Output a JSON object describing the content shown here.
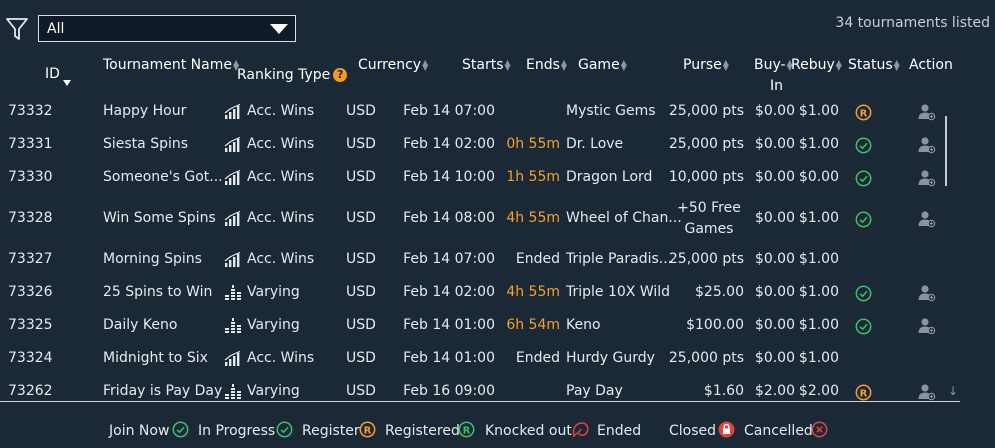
{
  "toolbar": {
    "filter_value": "All",
    "count_text": "34 tournaments listed"
  },
  "columns": {
    "id": "ID",
    "name": "Tournament Name",
    "ranking": "Ranking Type",
    "currency": "Currency",
    "starts": "Starts",
    "ends": "Ends",
    "game": "Game",
    "purse": "Purse",
    "buyin_1": "Buy-",
    "buyin_2": "In",
    "rebuy": "Rebuy",
    "status": "Status",
    "action": "Action"
  },
  "rows": [
    {
      "id": "73332",
      "name": "Happy Hour",
      "ranking_icon": "bar-chart-icon",
      "ranking": "Acc. Wins",
      "currency": "USD",
      "starts": "Feb 14 07:00",
      "ends": "",
      "ends_color": "",
      "game": "Mystic Gems",
      "purse": "25,000 pts",
      "purse2": "",
      "buyin": "$0.00",
      "rebuy": "$1.00",
      "status": "register",
      "action": "join-user-icon"
    },
    {
      "id": "73331",
      "name": "Siesta Spins",
      "ranking_icon": "bar-chart-icon",
      "ranking": "Acc. Wins",
      "currency": "USD",
      "starts": "Feb 14 02:00",
      "ends": "0h 55m",
      "ends_color": "#f5a030",
      "game": "Dr. Love",
      "purse": "25,000 pts",
      "purse2": "",
      "buyin": "$0.00",
      "rebuy": "$1.00",
      "status": "in-progress",
      "action": "join-user-icon"
    },
    {
      "id": "73330",
      "name": "Someone's Got...",
      "ranking_icon": "bar-chart-icon",
      "ranking": "Acc. Wins",
      "currency": "USD",
      "starts": "Feb 14 10:00",
      "ends": "1h 55m",
      "ends_color": "#f5a030",
      "game": "Dragon Lord",
      "purse": "10,000 pts",
      "purse2": "",
      "buyin": "$0.00",
      "rebuy": "$0.00",
      "status": "in-progress",
      "action": "join-user-icon"
    },
    {
      "id": "73328",
      "name": "Win Some Spins",
      "ranking_icon": "bar-chart-icon",
      "ranking": "Acc. Wins",
      "currency": "USD",
      "starts": "Feb 14 08:00",
      "ends": "4h 55m",
      "ends_color": "#f5a030",
      "game": "Wheel of Chan...",
      "purse": "+50 Free",
      "purse2": "Games",
      "buyin": "$0.00",
      "rebuy": "$1.00",
      "status": "in-progress",
      "action": "join-user-icon"
    },
    {
      "id": "73327",
      "name": "Morning Spins",
      "ranking_icon": "bar-chart-icon",
      "ranking": "Acc. Wins",
      "currency": "USD",
      "starts": "Feb 14 07:00",
      "ends": "Ended",
      "ends_color": "",
      "game": "Triple Paradis...",
      "purse": "25,000 pts",
      "purse2": "",
      "buyin": "$0.00",
      "rebuy": "$1.00",
      "status": "",
      "action": ""
    },
    {
      "id": "73326",
      "name": "25 Spins to Win",
      "ranking_icon": "coin-stack-icon",
      "ranking": "Varying",
      "currency": "USD",
      "starts": "Feb 14 02:00",
      "ends": "4h 55m",
      "ends_color": "#f5a030",
      "game": "Triple 10X Wild",
      "purse": "$25.00",
      "purse2": "",
      "buyin": "$0.00",
      "rebuy": "$1.00",
      "status": "in-progress",
      "action": "join-user-icon"
    },
    {
      "id": "73325",
      "name": "Daily Keno",
      "ranking_icon": "coin-stack-icon",
      "ranking": "Varying",
      "currency": "USD",
      "starts": "Feb 14 01:00",
      "ends": "6h 54m",
      "ends_color": "#f5a030",
      "game": "Keno",
      "purse": "$100.00",
      "purse2": "",
      "buyin": "$0.00",
      "rebuy": "$1.00",
      "status": "in-progress",
      "action": "join-user-icon"
    },
    {
      "id": "73324",
      "name": "Midnight to Six",
      "ranking_icon": "bar-chart-icon",
      "ranking": "Acc. Wins",
      "currency": "USD",
      "starts": "Feb 14 01:00",
      "ends": "Ended",
      "ends_color": "",
      "game": "Hurdy Gurdy",
      "purse": "25,000 pts",
      "purse2": "",
      "buyin": "$0.00",
      "rebuy": "$1.00",
      "status": "",
      "action": ""
    },
    {
      "id": "73262",
      "name": "Friday is Pay Day",
      "ranking_icon": "coin-stack-icon",
      "ranking": "Varying",
      "currency": "USD",
      "starts": "Feb 16 09:00",
      "ends": "",
      "ends_color": "",
      "game": "Pay Day",
      "purse": "$1.60",
      "purse2": "",
      "buyin": "$2.00",
      "rebuy": "$2.00",
      "status": "register",
      "action": "join-user-icon"
    }
  ],
  "legend": {
    "join_now": "Join Now",
    "in_progress": "In Progress",
    "register": "Register",
    "registered": "Registered",
    "knocked_out": "Knocked out",
    "ended": "Ended",
    "closed": "Closed",
    "cancelled": "Cancelled"
  },
  "colors": {
    "background": "#1b2836",
    "accent_orange": "#f5a030",
    "green": "#3fbf6a",
    "red": "#e0443e"
  }
}
